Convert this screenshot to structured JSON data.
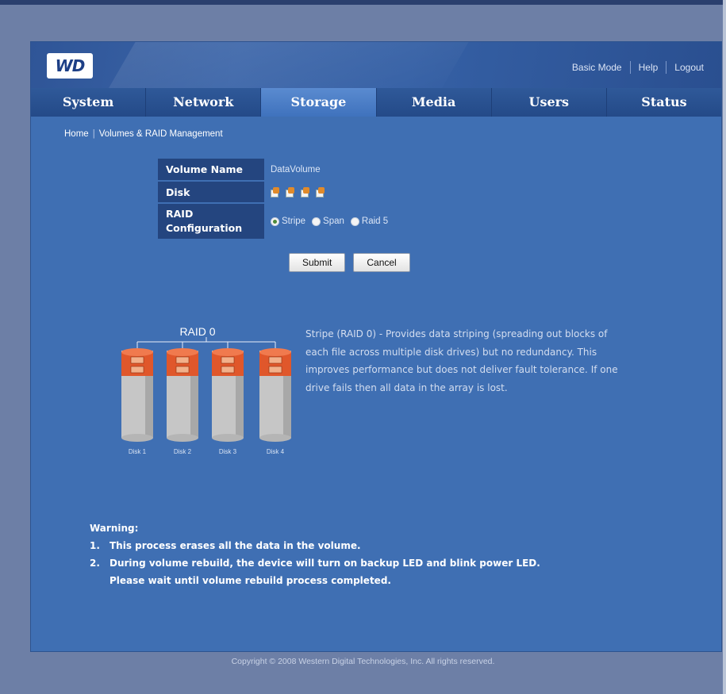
{
  "header": {
    "logo_text": "WD",
    "links": [
      "Basic Mode",
      "Help",
      "Logout"
    ]
  },
  "nav": {
    "tabs": [
      "System",
      "Network",
      "Storage",
      "Media",
      "Users",
      "Status"
    ],
    "active": "Storage"
  },
  "breadcrumb": {
    "home": "Home",
    "current": "Volumes & RAID Management"
  },
  "form": {
    "volume_name_label": "Volume Name",
    "volume_name_value": "DataVolume",
    "disk_label": "Disk",
    "raid_label_line1": "RAID",
    "raid_label_line2": "Configuration",
    "raid_options": [
      "Stripe",
      "Span",
      "Raid 5"
    ],
    "raid_selected": "Stripe",
    "submit_label": "Submit",
    "cancel_label": "Cancel"
  },
  "diagram": {
    "title": "RAID 0",
    "disk_labels": [
      "Disk 1",
      "Disk 2",
      "Disk 3",
      "Disk 4"
    ],
    "colors": {
      "cylinder": "#c6c6c6",
      "segment": "#e0572b"
    }
  },
  "description": "Stripe (RAID 0) - Provides data striping (spreading out blocks of each file across multiple disk drives) but no redundancy. This improves performance but does not deliver fault tolerance. If one drive fails then all data in the array is lost.",
  "warning": {
    "title": "Warning:",
    "items": [
      "This process erases all the data in the volume.",
      "During volume rebuild, the device will turn on backup LED and blink power LED."
    ],
    "continuation": "Please wait until volume rebuild process completed."
  },
  "footer": "Copyright © 2008 Western Digital Technologies, Inc. All rights reserved.",
  "colors": {
    "panel": "#3f6fb3",
    "nav_active": "#4f82c8",
    "label_bg": "#24457f"
  }
}
